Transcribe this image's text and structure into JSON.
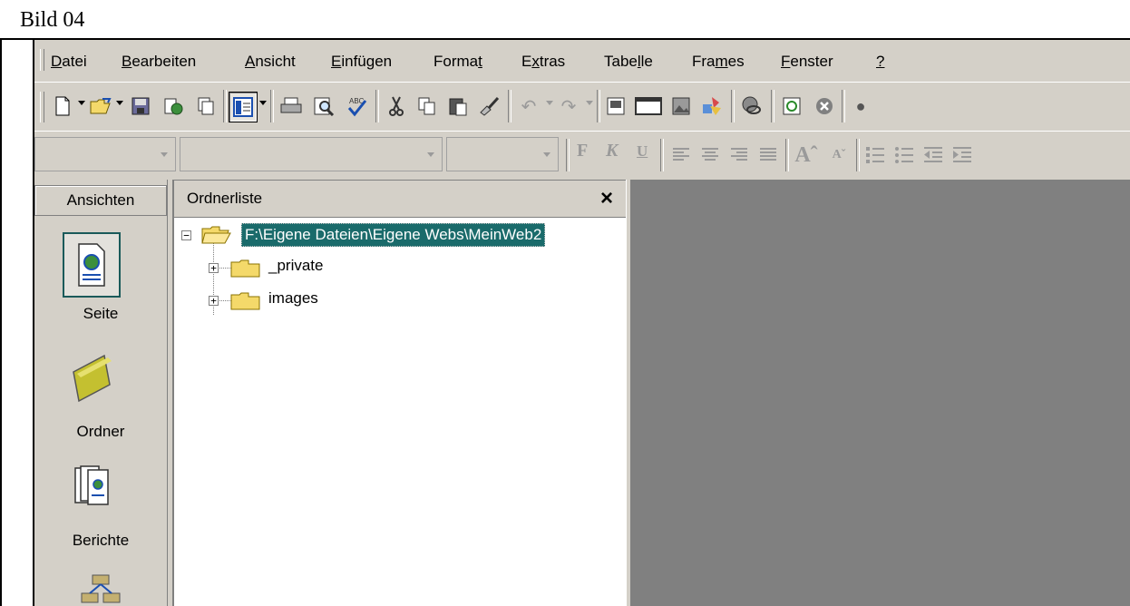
{
  "caption": "Bild 04",
  "menu": [
    {
      "label": "Datei",
      "underline": "D",
      "rest": "atei"
    },
    {
      "label": "Bearbeiten",
      "underline": "B",
      "rest": "earbeiten"
    },
    {
      "label": "Ansicht",
      "underline": "A",
      "rest": "nsicht"
    },
    {
      "label": "Einfügen",
      "underline": "E",
      "rest": "infügen"
    },
    {
      "label": "Format",
      "pre": "Forma",
      "underline": "t",
      "rest": ""
    },
    {
      "label": "Extras",
      "pre": "E",
      "underline": "x",
      "rest": "tras"
    },
    {
      "label": "Tabelle",
      "pre": "Tabe",
      "underline": "l",
      "rest": "le"
    },
    {
      "label": "Frames",
      "pre": "Fra",
      "underline": "m",
      "rest": "es"
    },
    {
      "label": "Fenster",
      "underline": "F",
      "rest": "enster"
    },
    {
      "label": "?",
      "underline": "?",
      "rest": ""
    }
  ],
  "format_toolbar": {
    "bold": "F",
    "italic": "K",
    "underline": "U"
  },
  "views": {
    "header": "Ansichten",
    "items": [
      {
        "label": "Seite",
        "icon": "page-icon"
      },
      {
        "label": "Ordner",
        "icon": "folder-icon"
      },
      {
        "label": "Berichte",
        "icon": "reports-icon"
      }
    ]
  },
  "folder_list": {
    "title": "Ordnerliste",
    "close": "×",
    "root": "F:\\Eigene Dateien\\Eigene Webs\\MeinWeb2",
    "children": [
      "_private",
      "images"
    ]
  },
  "colors": {
    "window_bg": "#d4d0c8",
    "selection": "#1a6b6b",
    "main_bg": "#808080"
  }
}
